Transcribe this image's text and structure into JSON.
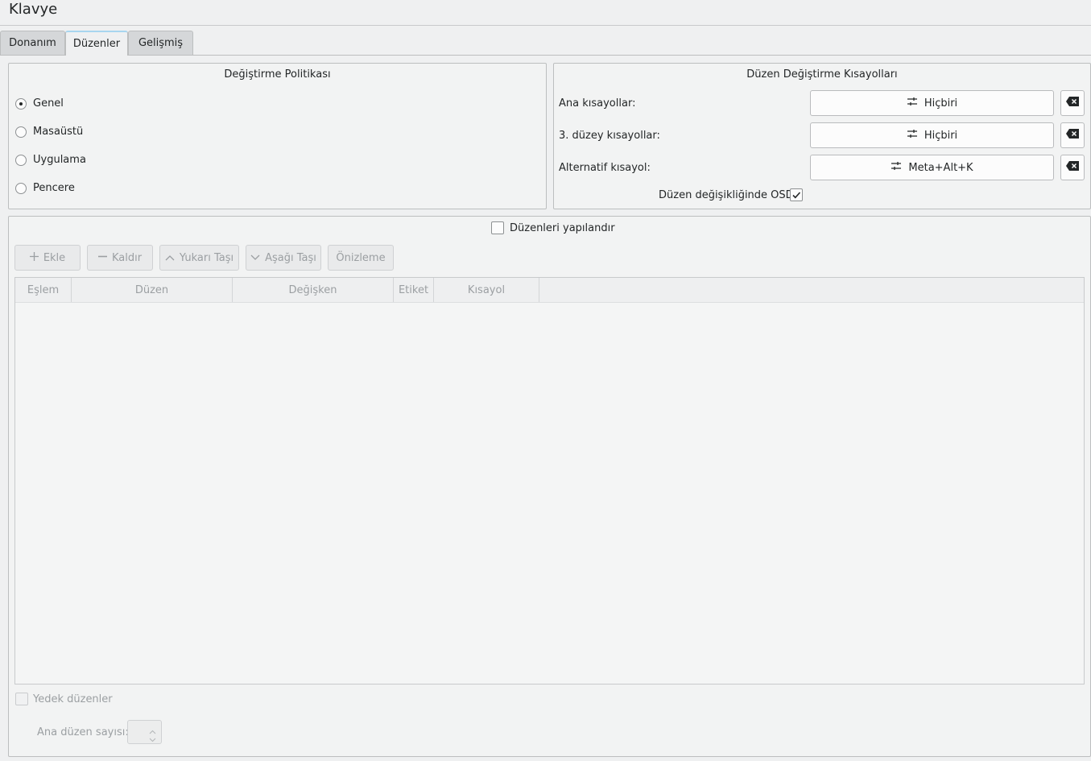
{
  "window": {
    "title": "Klavye"
  },
  "tabs": [
    {
      "label": "Donanım",
      "active": false
    },
    {
      "label": "Düzenler",
      "active": true
    },
    {
      "label": "Gelişmiş",
      "active": false
    }
  ],
  "switching_policy": {
    "title": "Değiştirme Politikası",
    "options": [
      {
        "label": "Genel",
        "checked": true
      },
      {
        "label": "Masaüstü",
        "checked": false
      },
      {
        "label": "Uygulama",
        "checked": false
      },
      {
        "label": "Pencere",
        "checked": false
      }
    ]
  },
  "shortcuts": {
    "title": "Düzen Değiştirme Kısayolları",
    "rows": [
      {
        "label": "Ana kısayollar:",
        "value": "Hiçbiri"
      },
      {
        "label": "3. düzey kısayollar:",
        "value": "Hiçbiri"
      },
      {
        "label": "Alternatif kısayol:",
        "value": "Meta+Alt+K"
      }
    ],
    "osd": {
      "label": "Düzen değişikliğinde OSD",
      "checked": true
    }
  },
  "layouts": {
    "configure_label": "Düzenleri yapılandır",
    "configure_checked": false,
    "toolbar": {
      "add": "Ekle",
      "remove": "Kaldır",
      "move_up": "Yukarı Taşı",
      "move_down": "Aşağı Taşı",
      "preview": "Önizleme"
    },
    "columns": [
      "Eşlem",
      "Düzen",
      "Değişken",
      "Etiket",
      "Kısayol"
    ],
    "rows": [],
    "spare_label": "Yedek düzenler",
    "main_count_label": "Ana düzen sayısı:",
    "main_count_value": ""
  },
  "colors": {
    "accent": "#3daee9",
    "disabled_text": "#9b9fa2"
  }
}
